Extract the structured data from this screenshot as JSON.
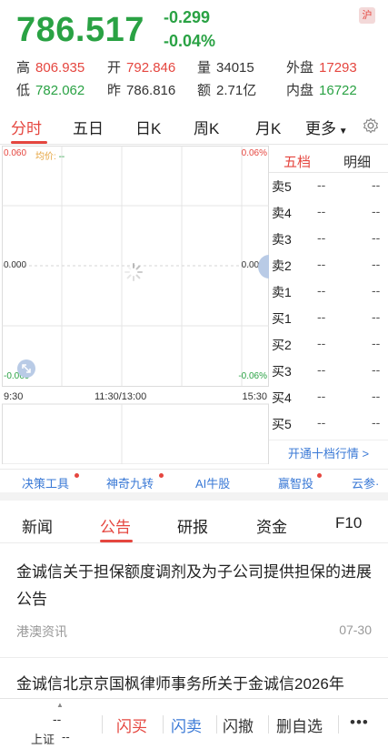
{
  "quote": {
    "price": "786.517",
    "change": "-0.299",
    "change_pct": "-0.04%",
    "market_badge": "沪",
    "stats": [
      {
        "label": "高",
        "value": "806.935"
      },
      {
        "label": "开",
        "value": "792.846"
      },
      {
        "label": "量",
        "value": "34015"
      },
      {
        "label": "外盘",
        "value": "17293"
      },
      {
        "label": "低",
        "value": "782.062"
      },
      {
        "label": "昨",
        "value": "786.816"
      },
      {
        "label": "额",
        "value": "2.71亿"
      },
      {
        "label": "内盘",
        "value": "16722"
      }
    ]
  },
  "chart_tabs": [
    "分时",
    "五日",
    "日K",
    "周K",
    "月K",
    "更多"
  ],
  "chart": {
    "price_top": "0.060",
    "avg_label": "均价:",
    "avg_value": "--",
    "price_mid": "0.000",
    "price_bottom": "-0.060",
    "pct_top": "0.06%",
    "pct_mid": "0.00%",
    "pct_bottom": "-0.06%",
    "times": [
      "9:30",
      "11:30/13:00",
      "15:30"
    ]
  },
  "order_book": {
    "tabs": [
      "五档",
      "明细"
    ],
    "rows": [
      {
        "name": "卖5",
        "price": "--",
        "vol": "--"
      },
      {
        "name": "卖4",
        "price": "--",
        "vol": "--"
      },
      {
        "name": "卖3",
        "price": "--",
        "vol": "--"
      },
      {
        "name": "卖2",
        "price": "--",
        "vol": "--"
      },
      {
        "name": "卖1",
        "price": "--",
        "vol": "--"
      },
      {
        "name": "买1",
        "price": "--",
        "vol": "--"
      },
      {
        "name": "买2",
        "price": "--",
        "vol": "--"
      },
      {
        "name": "买3",
        "price": "--",
        "vol": "--"
      },
      {
        "name": "买4",
        "price": "--",
        "vol": "--"
      },
      {
        "name": "买5",
        "price": "--",
        "vol": "--"
      }
    ],
    "open_level10": "开通十档行情 >"
  },
  "tools": [
    "决策工具",
    "神奇九转",
    "AI牛股",
    "赢智投",
    "云参·"
  ],
  "news_tabs": [
    "新闻",
    "公告",
    "研报",
    "资金",
    "F10"
  ],
  "articles": [
    {
      "title": "金诚信关于担保额度调剂及为子公司提供担保的进展公告",
      "source": "港澳资讯",
      "date": "07-30"
    },
    {
      "title": "金诚信北京京国枫律师事务所关于金诚信2026年",
      "source": "",
      "date": ""
    }
  ],
  "bottom_bar": {
    "index_value": "--",
    "index_name": "上证",
    "index_change": "--",
    "buy": "闪买",
    "sell": "闪卖",
    "cancel": "闪撤",
    "delete_watch": "删自选",
    "more": "•••"
  },
  "colors": {
    "up": "#e5463f",
    "down": "#2aa244",
    "link": "#3a79d6"
  }
}
